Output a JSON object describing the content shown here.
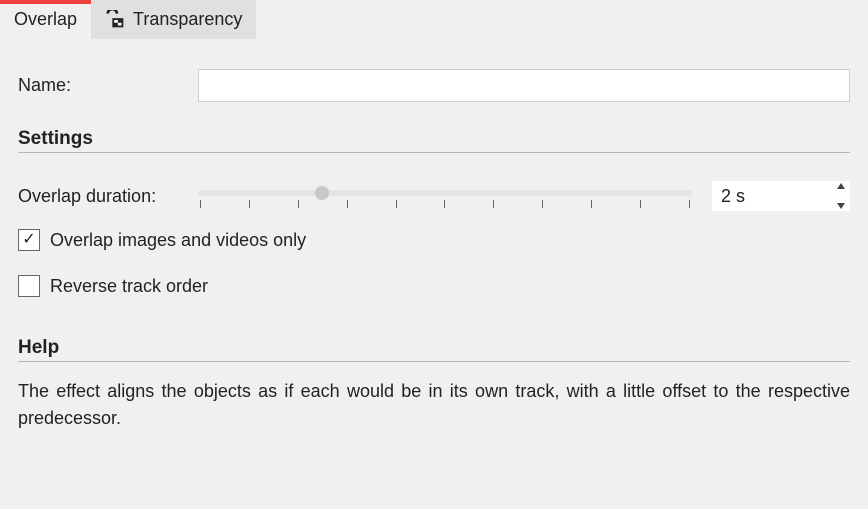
{
  "tabs": {
    "overlap": "Overlap",
    "transparency": "Transparency"
  },
  "name_label": "Name:",
  "name_value": "",
  "sections": {
    "settings": "Settings",
    "help": "Help"
  },
  "overlap_duration_label": "Overlap duration:",
  "overlap_duration_value": "2 s",
  "overlap_slider_percent": 25,
  "ticks_count": 11,
  "checkbox_overlap_only": {
    "label": "Overlap images and videos only",
    "checked": true
  },
  "checkbox_reverse": {
    "label": "Reverse track order",
    "checked": false
  },
  "help_text": "The effect aligns the objects as if each would be in its own track, with a little offset to the respective predecessor."
}
